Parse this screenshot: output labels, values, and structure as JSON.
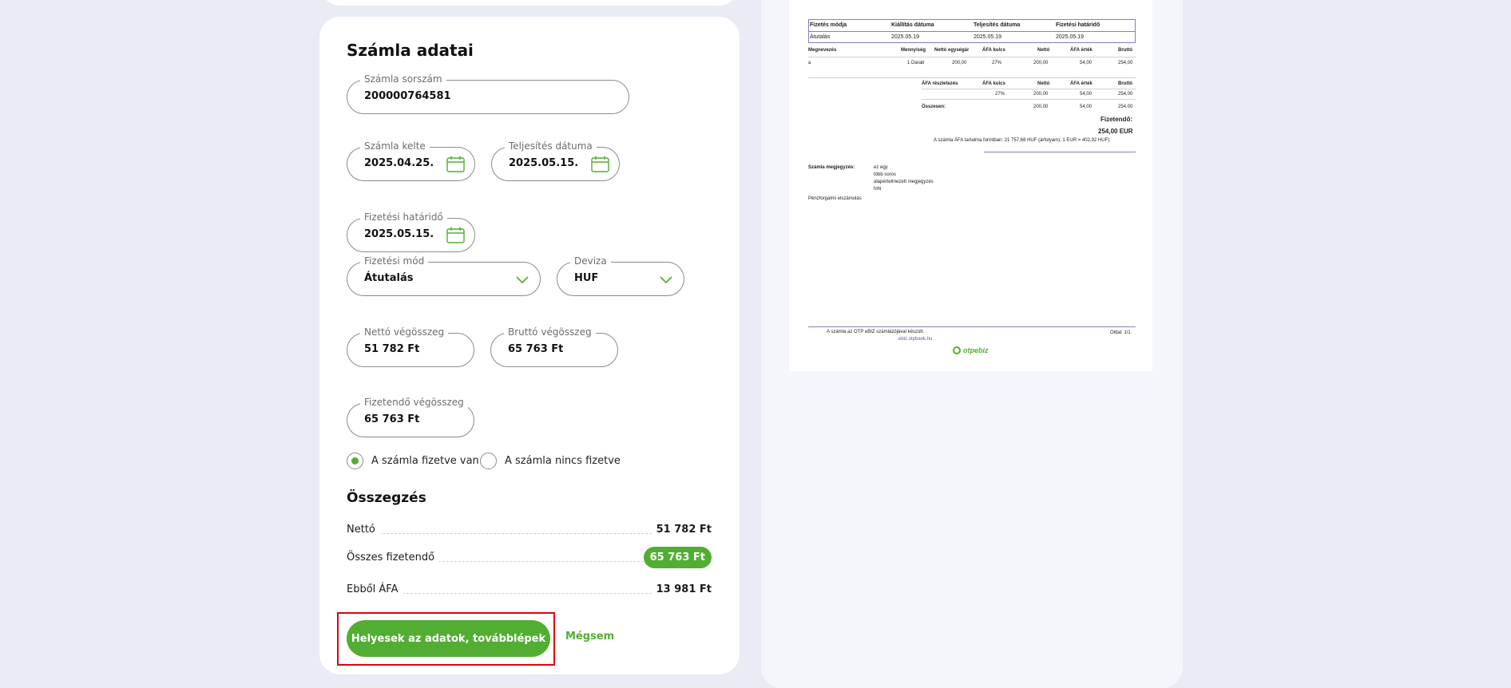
{
  "form": {
    "title": "Számla adatai",
    "invoice_number": {
      "label": "Számla sorszám",
      "value": "200000764581"
    },
    "issue_date": {
      "label": "Számla kelte",
      "value": "2025.04.25."
    },
    "completion_date": {
      "label": "Teljesítés dátuma",
      "value": "2025.05.15."
    },
    "payment_deadline": {
      "label": "Fizetési határidő",
      "value": "2025.05.15."
    },
    "payment_method": {
      "label": "Fizetési mód",
      "value": "Átutalás"
    },
    "currency": {
      "label": "Deviza",
      "value": "HUF"
    },
    "net_total": {
      "label": "Nettó végösszeg",
      "value": "51 782 Ft"
    },
    "gross_total": {
      "label": "Bruttó végösszeg",
      "value": "65 763 Ft"
    },
    "payable_total": {
      "label": "Fizetendő végösszeg",
      "value": "65 763 Ft"
    },
    "radio_paid": "A számla fizetve van",
    "radio_unpaid": "A számla nincs fizetve",
    "paid_selected": true
  },
  "summary": {
    "title": "Összegzés",
    "net_label": "Nettó",
    "net_value": "51 782 Ft",
    "total_label": "Összes fizetendő",
    "total_value": "65 763 Ft",
    "vat_label": "Ebből ÁFA",
    "vat_value": "13 981 Ft"
  },
  "actions": {
    "confirm": "Helyesek az adatok, továbblépek",
    "cancel": "Mégsem"
  },
  "colors": {
    "accent": "#52ae32",
    "highlight": "#e3000f"
  },
  "preview": {
    "top_header": {
      "payment_method": "Fizetés módja",
      "issue_date": "Kiállítás dátuma",
      "completion_date": "Teljesítés dátuma",
      "deadline": "Fizetési határidő"
    },
    "top_values": {
      "payment_method": "Átutalás",
      "issue_date": "2025.05.19",
      "completion_date": "2025.05.19",
      "deadline": "2025.05.19"
    },
    "item_headers": [
      "Megnevezés",
      "Mennyiség",
      "Nettó egységár",
      "ÁFA kulcs",
      "Nettó",
      "ÁFA érték",
      "Bruttó"
    ],
    "item_row": [
      "a",
      "1 Darab",
      "200,00",
      "27%",
      "200,00",
      "54,00",
      "254,00"
    ],
    "vat_headers": [
      "ÁFA részletezés",
      "ÁFA kulcs",
      "Nettó",
      "ÁFA érték",
      "Bruttó"
    ],
    "vat_row": [
      "27%",
      "200,00",
      "54,00",
      "254,00"
    ],
    "sum_label": "Összesen:",
    "sum_row": [
      "200,00",
      "54,00",
      "254,00"
    ],
    "payable_label": "Fizetendő:",
    "payable_value": "254,00 EUR",
    "vat_note": "A számla ÁFA tartalma forintban: 21 757,68 HUF (árfolyam): 1 EUR = 402,92 HUF)",
    "note_label": "Számla megjegyzés:",
    "note_lines": [
      "ez egy",
      "több soros",
      "alapértelmezett megjegyzés",
      "hihi"
    ],
    "reverse_charge": "Pénzforgalmi elszámolás",
    "footer_made": "A számla az OTP eBIZ számlázójával készült.",
    "footer_link": "ebiz.otpbank.hu",
    "footer_page": "Oldal: 1/1",
    "logo": "otpebiz"
  }
}
